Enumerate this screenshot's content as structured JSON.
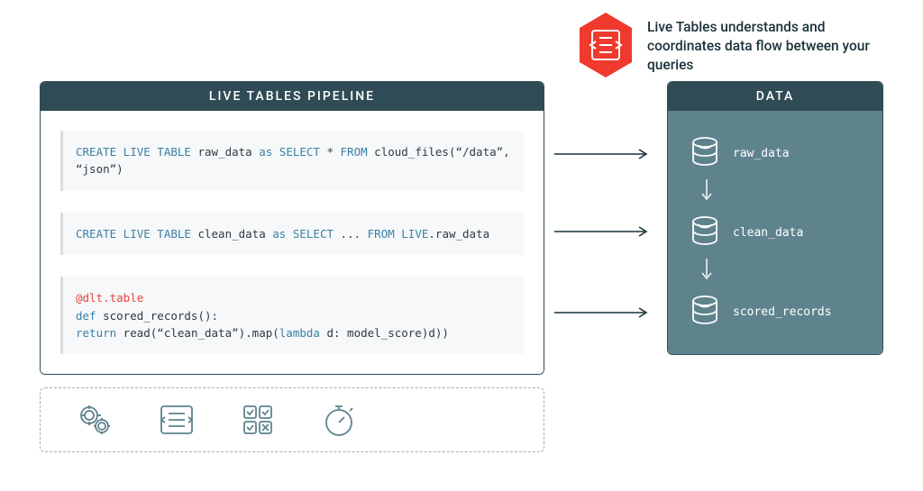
{
  "tagline": "Live Tables understands and coordinates data flow between your queries",
  "pipeline": {
    "title": "LIVE TABLES PIPELINE",
    "statements": [
      {
        "tokens": [
          {
            "t": "CREATE LIVE TABLE",
            "c": "kw"
          },
          {
            "t": " raw_data "
          },
          {
            "t": "as",
            "c": "kw"
          },
          {
            "t": " "
          },
          {
            "t": "SELECT",
            "c": "kw"
          },
          {
            "t": " * "
          },
          {
            "t": "FROM",
            "c": "kw"
          },
          {
            "t": " cloud_files(“/data”, “json”)"
          }
        ]
      },
      {
        "tokens": [
          {
            "t": "CREATE LIVE TABLE",
            "c": "kw"
          },
          {
            "t": " clean_data "
          },
          {
            "t": "as",
            "c": "kw"
          },
          {
            "t": " "
          },
          {
            "t": "SELECT",
            "c": "kw"
          },
          {
            "t": " ... "
          },
          {
            "t": "FROM",
            "c": "kw"
          },
          {
            "t": " "
          },
          {
            "t": "LIVE",
            "c": "kw"
          },
          {
            "t": ".raw_data"
          }
        ]
      },
      {
        "lines": [
          [
            {
              "t": "@dlt.table",
              "c": "decorator"
            }
          ],
          [
            {
              "t": "def",
              "c": "kw"
            },
            {
              "t": " scored_records():"
            }
          ],
          [
            {
              "t": "  "
            },
            {
              "t": "return",
              "c": "kw"
            },
            {
              "t": " read(“clean_data”).map("
            },
            {
              "t": "lambda",
              "c": "kw"
            },
            {
              "t": " d: model_score)d))"
            }
          ]
        ]
      }
    ]
  },
  "data_panel": {
    "title": "DATA",
    "items": [
      "raw_data",
      "clean_data",
      "scored_records"
    ]
  },
  "icon_strip": [
    "cogs-icon",
    "flow-icon",
    "grid-icon",
    "timer-icon"
  ]
}
